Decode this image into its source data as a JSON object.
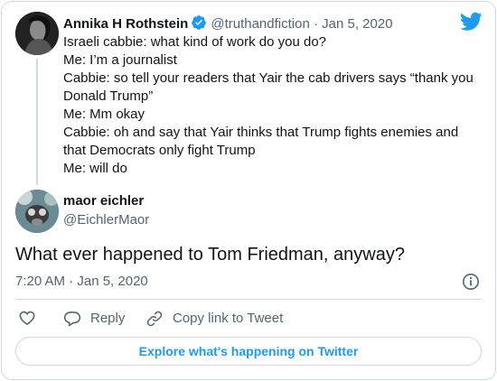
{
  "parent_tweet": {
    "name": "Annika H Rothstein",
    "handle": "@truthandfiction",
    "date": "Jan 5, 2020",
    "lines": [
      "Israeli cabbie: what kind of work do you do?",
      "Me: I’m a journalist",
      "Cabbie: so tell your readers that Yair the cab drivers says “thank you",
      "Donald Trump”",
      "Me: Mm okay",
      "Cabbie: oh and say that Yair thinks that Trump fights enemies and",
      "that Democrats only fight Trump",
      "Me: will do"
    ]
  },
  "main_tweet": {
    "name": "maor eichler",
    "handle": "@EichlerMaor",
    "text": "What ever happened to Tom Friedman, anyway?",
    "timestamp": "7:20 AM · Jan 5, 2020"
  },
  "actions": {
    "reply_label": "Reply",
    "copy_link_label": "Copy link to Tweet"
  },
  "explore_label": "Explore what's happening on Twitter",
  "colors": {
    "brand": "#1d9bf0",
    "text": "#0f1419",
    "secondary": "#536471",
    "border": "#cfd9de"
  },
  "icons": [
    "twitter-logo-icon",
    "verified-badge-icon",
    "info-icon",
    "heart-icon",
    "reply-icon",
    "link-icon"
  ]
}
